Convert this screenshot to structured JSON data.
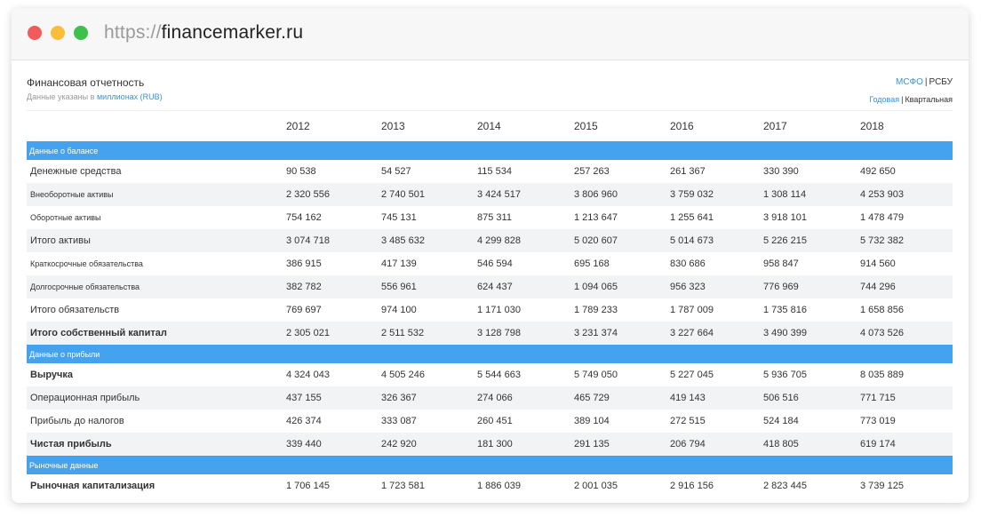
{
  "browser": {
    "url_scheme": "https://",
    "url_host": "financemarker.ru"
  },
  "header": {
    "title": "Финансовая отчетность",
    "subtitle_prefix": "Данные указаны в",
    "subtitle_unit": "миллионах (RUB)",
    "std_active": "МСФО",
    "std_separator": "|",
    "std_other": "РСБУ",
    "period_active": "Годовая",
    "period_separator": "|",
    "period_other": "Квартальная"
  },
  "table": {
    "years": [
      "2012",
      "2013",
      "2014",
      "2015",
      "2016",
      "2017",
      "2018"
    ],
    "sections": [
      {
        "title": "Данные о балансе",
        "rows": [
          {
            "label": "Денежные средства",
            "style": "big",
            "values": [
              "90 538",
              "54 527",
              "115 534",
              "257 263",
              "261 367",
              "330 390",
              "492 650"
            ]
          },
          {
            "label": "Внеоборотные активы",
            "style": "small",
            "values": [
              "2 320 556",
              "2 740 501",
              "3 424 517",
              "3 806 960",
              "3 759 032",
              "1 308 114",
              "4 253 903"
            ]
          },
          {
            "label": "Оборотные активы",
            "style": "small",
            "values": [
              "754 162",
              "745 131",
              "875 311",
              "1 213 647",
              "1 255 641",
              "3 918 101",
              "1 478 479"
            ]
          },
          {
            "label": "Итого активы",
            "style": "big",
            "values": [
              "3 074 718",
              "3 485 632",
              "4 299 828",
              "5 020 607",
              "5 014 673",
              "5 226 215",
              "5 732 382"
            ]
          },
          {
            "label": "Краткосрочные обязательства",
            "style": "small",
            "values": [
              "386 915",
              "417 139",
              "546 594",
              "695 168",
              "830 686",
              "958 847",
              "914 560"
            ]
          },
          {
            "label": "Долгосрочные обязательства",
            "style": "small",
            "values": [
              "382 782",
              "556 961",
              "624 437",
              "1 094 065",
              "956 323",
              "776 969",
              "744 296"
            ]
          },
          {
            "label": "Итого обязательств",
            "style": "big",
            "values": [
              "769 697",
              "974 100",
              "1 171 030",
              "1 789 233",
              "1 787 009",
              "1 735 816",
              "1 658 856"
            ]
          },
          {
            "label": "Итого собственный капитал",
            "style": "bold",
            "values": [
              "2 305 021",
              "2 511 532",
              "3 128 798",
              "3 231 374",
              "3 227 664",
              "3 490 399",
              "4 073 526"
            ]
          }
        ]
      },
      {
        "title": "Данные о прибыли",
        "rows": [
          {
            "label": "Выручка",
            "style": "bold",
            "values": [
              "4 324 043",
              "4 505 246",
              "5 544 663",
              "5 749 050",
              "5 227 045",
              "5 936 705",
              "8 035 889"
            ]
          },
          {
            "label": "Операционная прибыль",
            "style": "big",
            "values": [
              "437 155",
              "326 367",
              "274 066",
              "465 729",
              "419 143",
              "506 516",
              "771 715"
            ]
          },
          {
            "label": "Прибыль до налогов",
            "style": "big",
            "values": [
              "426 374",
              "333 087",
              "260 451",
              "389 104",
              "272 515",
              "524 184",
              "773 019"
            ]
          },
          {
            "label": "Чистая прибыль",
            "style": "bold",
            "values": [
              "339 440",
              "242 920",
              "181 300",
              "291 135",
              "206 794",
              "418 805",
              "619 174"
            ]
          }
        ]
      },
      {
        "title": "Рыночные данные",
        "rows": [
          {
            "label": "Рыночная капитализация",
            "style": "bold",
            "values": [
              "1 706 145",
              "1 723 581",
              "1 886 039",
              "2 001 035",
              "2 916 156",
              "2 823 445",
              "3 739 125"
            ]
          }
        ]
      }
    ]
  }
}
